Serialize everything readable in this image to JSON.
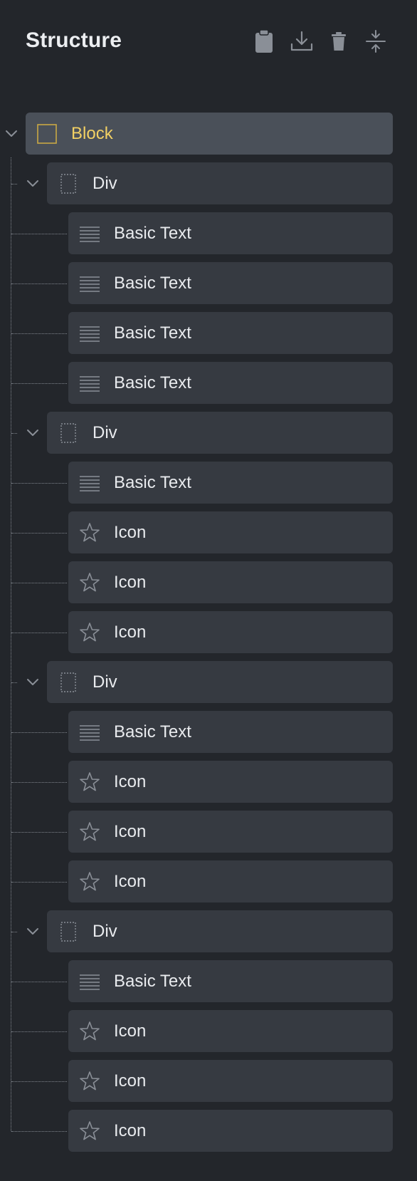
{
  "panel": {
    "title": "Structure",
    "toolbar": [
      {
        "name": "clipboard-icon",
        "label": "Paste"
      },
      {
        "name": "download-icon",
        "label": "Import"
      },
      {
        "name": "trash-icon",
        "label": "Delete"
      },
      {
        "name": "collapse-icon",
        "label": "Collapse all"
      }
    ]
  },
  "colors": {
    "background": "#23262b",
    "row": "#363a41",
    "row_selected": "#4a5059",
    "accent": "#f2d064",
    "text": "#e9ebee",
    "icon": "#8a8f97"
  },
  "tree": {
    "label": "Block",
    "icon": "block-square-icon",
    "expanded": true,
    "children": [
      {
        "label": "Div",
        "icon": "div-dotted-square-icon",
        "expanded": true,
        "children": [
          {
            "label": "Basic Text",
            "icon": "text-lines-icon"
          },
          {
            "label": "Basic Text",
            "icon": "text-lines-icon"
          },
          {
            "label": "Basic Text",
            "icon": "text-lines-icon"
          },
          {
            "label": "Basic Text",
            "icon": "text-lines-icon"
          }
        ]
      },
      {
        "label": "Div",
        "icon": "div-dotted-square-icon",
        "expanded": true,
        "children": [
          {
            "label": "Basic Text",
            "icon": "text-lines-icon"
          },
          {
            "label": "Icon",
            "icon": "star-icon"
          },
          {
            "label": "Icon",
            "icon": "star-icon"
          },
          {
            "label": "Icon",
            "icon": "star-icon"
          }
        ]
      },
      {
        "label": "Div",
        "icon": "div-dotted-square-icon",
        "expanded": true,
        "children": [
          {
            "label": "Basic Text",
            "icon": "text-lines-icon"
          },
          {
            "label": "Icon",
            "icon": "star-icon"
          },
          {
            "label": "Icon",
            "icon": "star-icon"
          },
          {
            "label": "Icon",
            "icon": "star-icon"
          }
        ]
      },
      {
        "label": "Div",
        "icon": "div-dotted-square-icon",
        "expanded": true,
        "children": [
          {
            "label": "Basic Text",
            "icon": "text-lines-icon"
          },
          {
            "label": "Icon",
            "icon": "star-icon"
          },
          {
            "label": "Icon",
            "icon": "star-icon"
          },
          {
            "label": "Icon",
            "icon": "star-icon"
          }
        ]
      }
    ]
  }
}
